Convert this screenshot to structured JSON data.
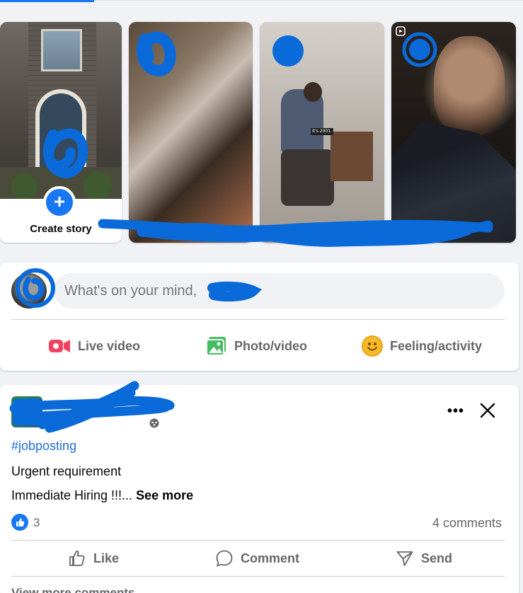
{
  "stories": {
    "create_label": "Create story",
    "reel_label": "reel"
  },
  "story_3": {
    "sign_text": "It's 2001."
  },
  "composer": {
    "placeholder": "What's on your mind,",
    "live_label": "Live video",
    "photo_label": "Photo/video",
    "feeling_label": "Feeling/activity"
  },
  "post": {
    "hashtag": "#jobposting",
    "line1": "Urgent requirement",
    "line2": "Immediate Hiring !!!...",
    "see_more": "See more",
    "like_count": "3",
    "comments": "4 comments",
    "actions": {
      "like": "Like",
      "comment": "Comment",
      "send": "Send"
    },
    "view_more": "View more comments"
  },
  "colors": {
    "accent": "#1877f2",
    "scribble": "#0a6ad9",
    "live_red": "#f3425f",
    "photo_green": "#45bd62",
    "feeling_yellow": "#f7b928"
  }
}
